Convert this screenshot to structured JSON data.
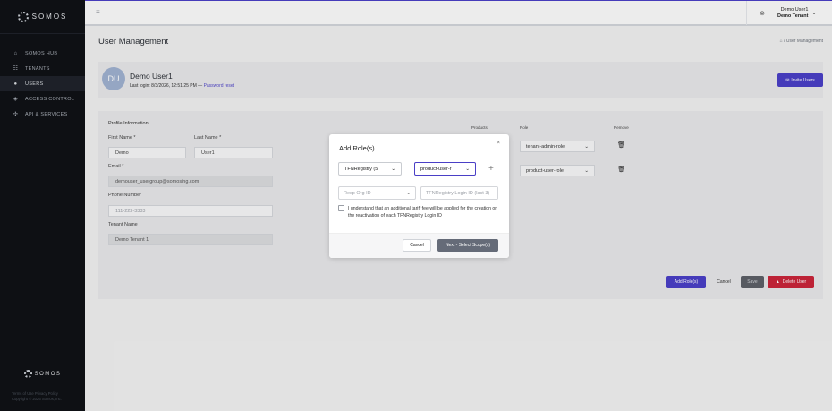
{
  "brand": {
    "name": "SOMOS"
  },
  "sidebar": {
    "items": [
      {
        "label": "SOMOS HUB",
        "icon": "home-icon"
      },
      {
        "label": "TENANTS",
        "icon": "users-group-icon"
      },
      {
        "label": "USERS",
        "icon": "user-icon"
      },
      {
        "label": "ACCESS CONTROL",
        "icon": "shield-icon"
      },
      {
        "label": "API & SERVICES",
        "icon": "api-icon"
      }
    ],
    "active_index": 2,
    "footer_logo": "SOMOS",
    "footer_links": "Terms of Use    Privacy Policy",
    "copyright": "Copyright © 2026 Somos, Inc."
  },
  "topbar": {
    "user_name": "Demo User1",
    "tenant_name": "Demo Tenant"
  },
  "page": {
    "title": "User Management",
    "breadcrumb": "/ User Management"
  },
  "profile": {
    "initials": "DU",
    "name": "Demo User1",
    "last_login": "Last login: 8/3/2026, 12:51:25 PM —",
    "password_reset": "Password reset",
    "invite_label": "Invite Users"
  },
  "info": {
    "section_title": "Profile Information",
    "first_name_label": "First Name *",
    "first_name": "Demo",
    "last_name_label": "Last Name *",
    "last_name": "User1",
    "email_label": "Email *",
    "email": "demouser_usergroup@somosing.com",
    "phone_label": "Phone Number",
    "phone_placeholder": "111-222-3333",
    "tenant_label": "Tenant Name",
    "tenant": "Demo Tenant 1",
    "columns": {
      "products": "Products",
      "role": "Role",
      "remove": "Remove"
    },
    "roles": [
      "tenant-admin-role",
      "product-user-role"
    ],
    "buttons": {
      "add_roles": "Add Role(s)",
      "cancel": "Cancel",
      "save": "Save",
      "delete": "Delete User"
    }
  },
  "modal": {
    "title": "Add Role(s)",
    "product_select": "TFNRegistry (5",
    "role_select": "product-user-r",
    "resp_org_placeholder": "Resp Org ID",
    "login_placeholder": "TFNRegistry Login ID (last 3)",
    "checkbox_text": "I understand that an additional tariff fee will be applied for the creation or the reactivation of each TFNRegistry Login ID",
    "cancel": "Cancel",
    "next": "Next - Select Scope(s)"
  },
  "colors": {
    "accent": "#4a3fc6",
    "danger": "#c9253a",
    "sidebar_bg": "#0f1116"
  }
}
